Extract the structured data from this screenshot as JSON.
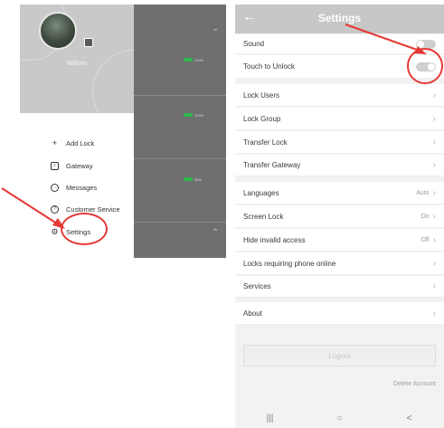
{
  "left_panel": {
    "user": {
      "name": "William"
    },
    "device_list": [
      {
        "battery": "100%"
      },
      {
        "battery": "100%"
      },
      {
        "battery": "95%"
      }
    ],
    "menu": [
      {
        "label": "Add Lock",
        "icon": "plus-icon"
      },
      {
        "label": "Gateway",
        "icon": "gateway-icon"
      },
      {
        "label": "Messages",
        "icon": "message-icon"
      },
      {
        "label": "Customer Service",
        "icon": "customer-service-icon"
      },
      {
        "label": "Settings",
        "icon": "gear-icon"
      }
    ]
  },
  "right_panel": {
    "title": "Settings",
    "groups": [
      [
        {
          "label": "Sound",
          "type": "toggle",
          "state": "off"
        },
        {
          "label": "Touch to Unlock",
          "type": "toggle",
          "state": "on"
        }
      ],
      [
        {
          "label": "Lock Users",
          "type": "link"
        },
        {
          "label": "Lock Group",
          "type": "link"
        },
        {
          "label": "Transfer Lock",
          "type": "link"
        },
        {
          "label": "Transfer Gateway",
          "type": "link"
        }
      ],
      [
        {
          "label": "Languages",
          "type": "value",
          "value": "Auto"
        },
        {
          "label": "Screen Lock",
          "type": "value",
          "value": "On"
        },
        {
          "label": "Hide invalid access",
          "type": "value",
          "value": "Off"
        },
        {
          "label": "Locks requiring phone online",
          "type": "link"
        },
        {
          "label": "Services",
          "type": "link"
        }
      ],
      [
        {
          "label": "About",
          "type": "link"
        }
      ]
    ],
    "logout_label": "Logout",
    "delete_account_label": "Delete Account",
    "navbar": {
      "recents": "|||",
      "home": "○",
      "back": "<"
    }
  },
  "colors": {
    "annotation": "#e53935",
    "battery": "#2fb84a"
  }
}
